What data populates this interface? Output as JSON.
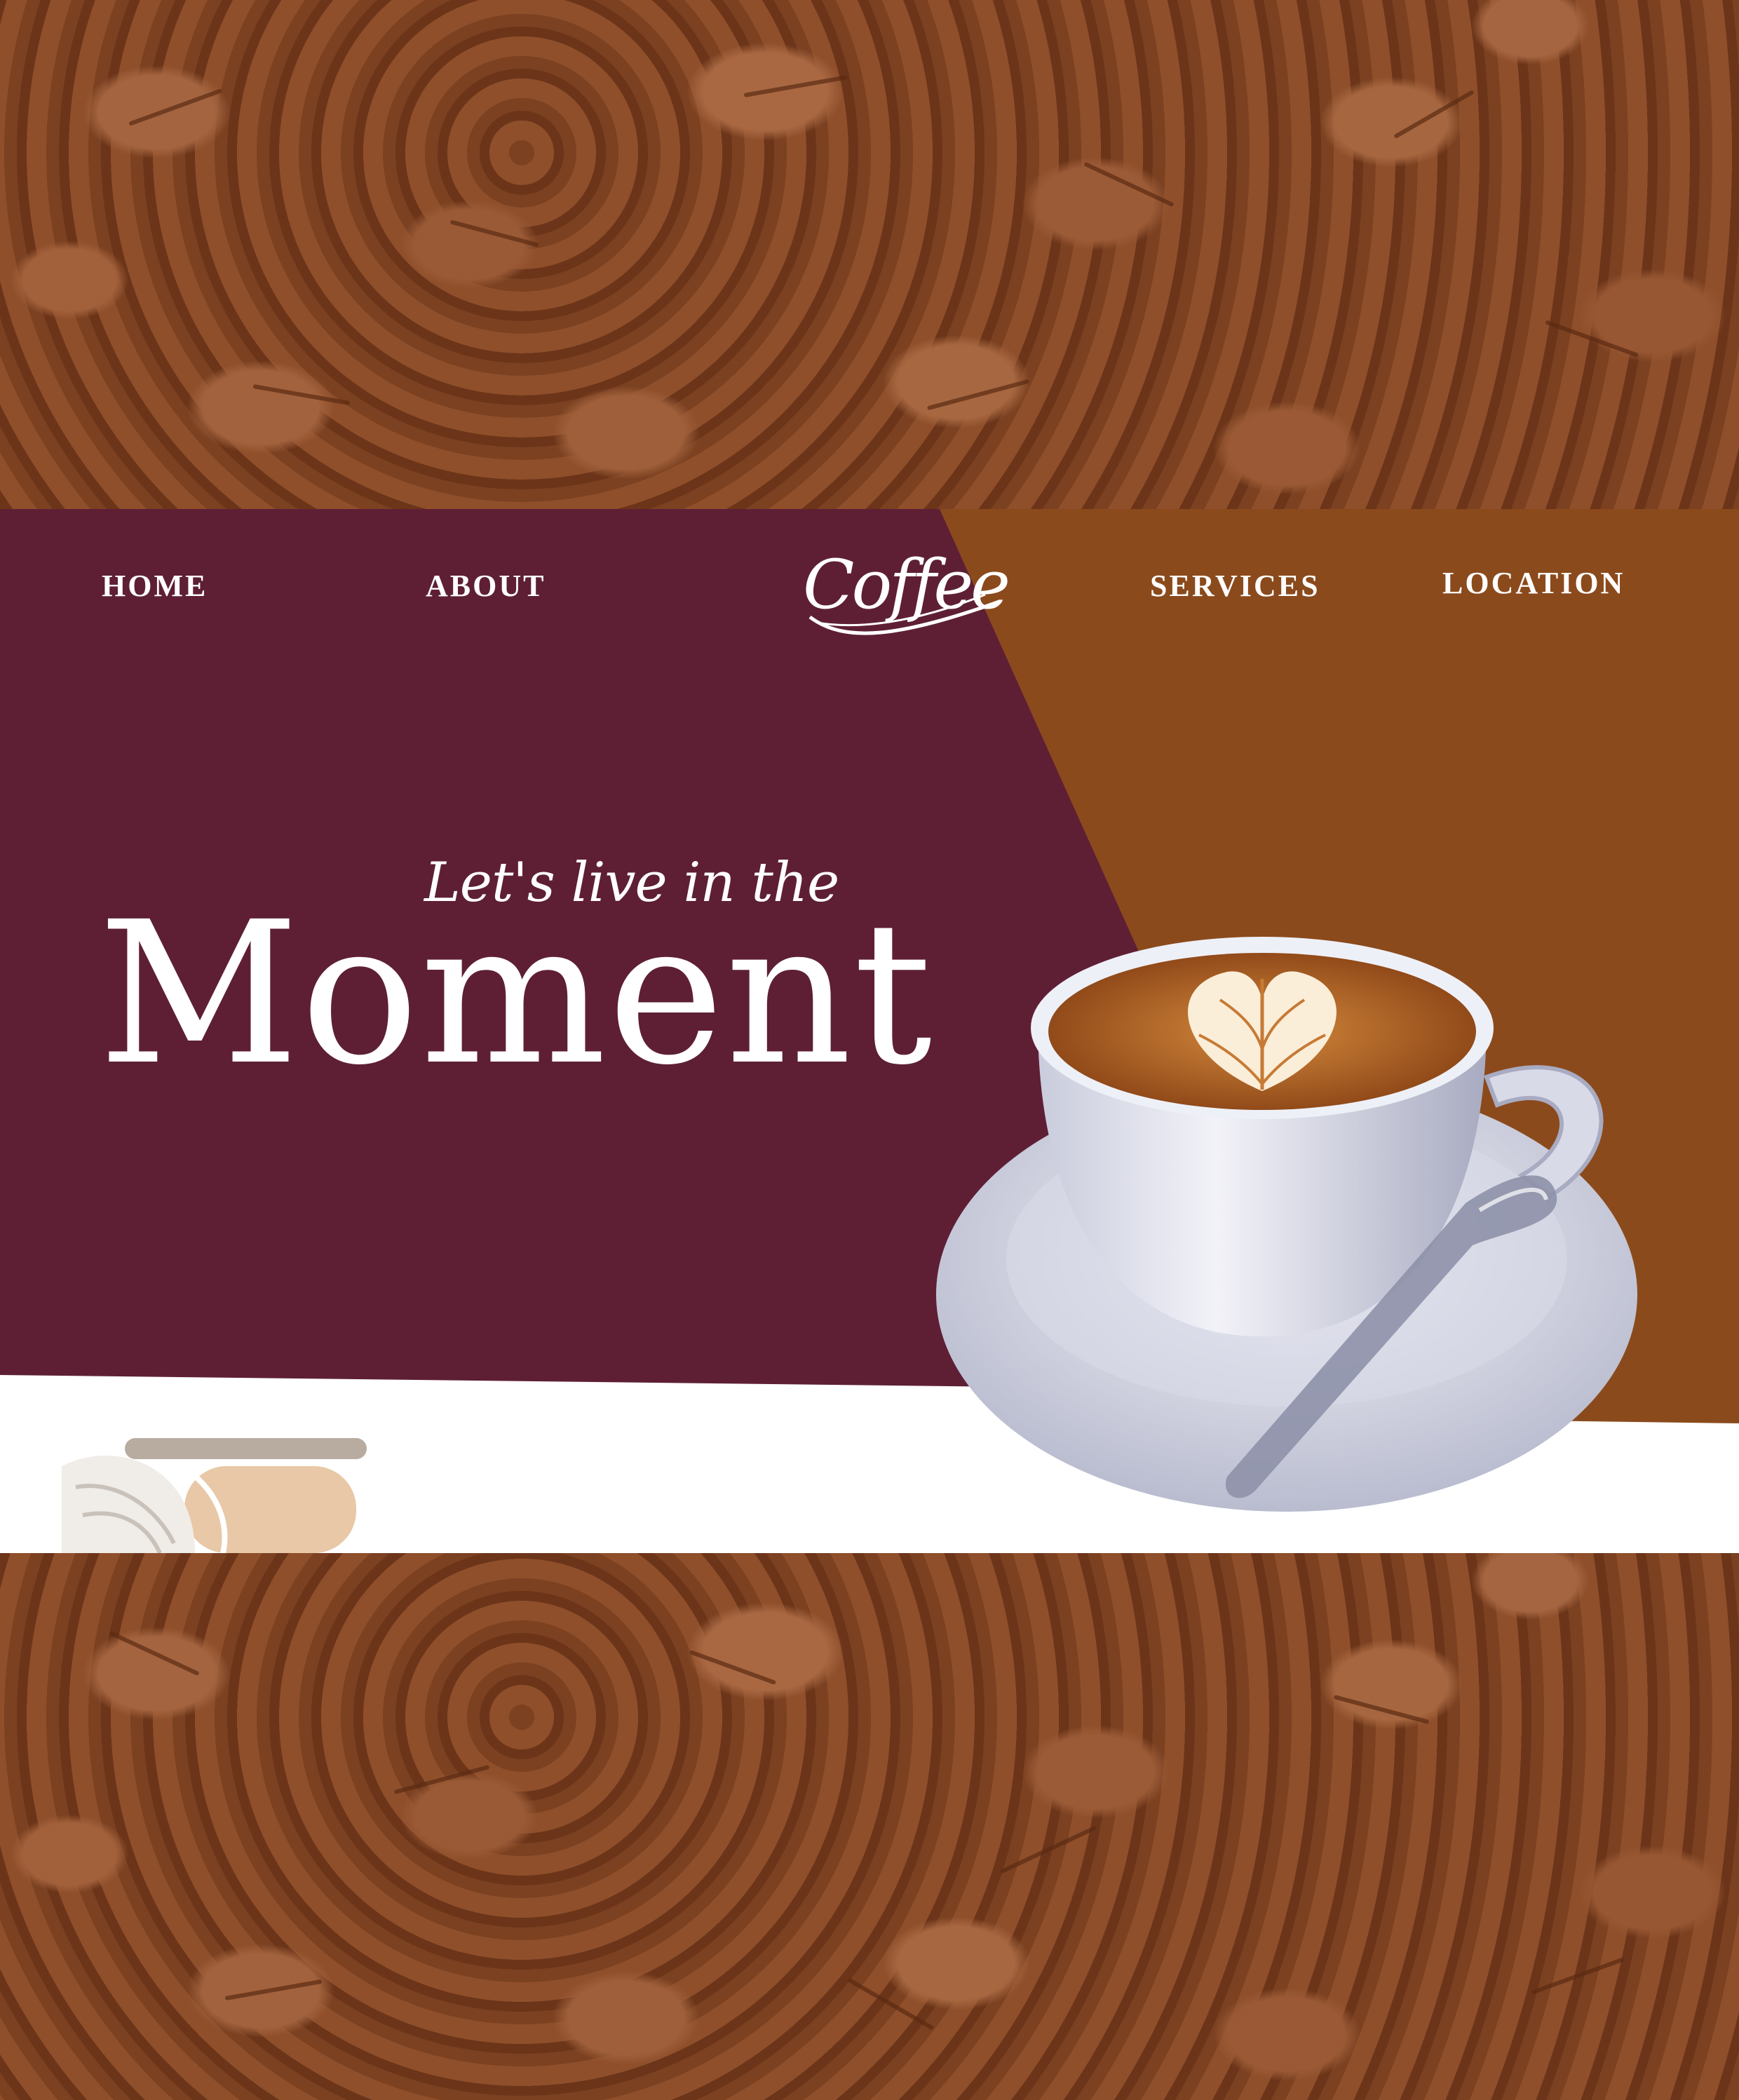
{
  "nav": {
    "items": [
      {
        "label": "HOME"
      },
      {
        "label": "ABOUT"
      },
      {
        "label": "SERVICES"
      },
      {
        "label": "LOCATION"
      }
    ],
    "logo_text": "Coffee"
  },
  "hero": {
    "tagline": "Let's live in the",
    "headline": "Moment"
  },
  "colors": {
    "maroon": "#5e1f35",
    "caramel": "#8b4a1c",
    "white": "#ffffff",
    "bean": "#8a4a27"
  },
  "icons": [
    "coffee-logo",
    "latte-cup-image",
    "coffee-leaf-illustration"
  ]
}
